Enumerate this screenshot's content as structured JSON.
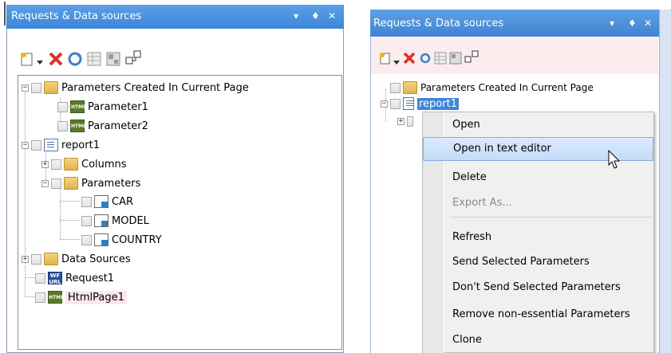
{
  "left_panel": {
    "title": "Requests & Data sources",
    "title_buttons": [
      "▾",
      "♦",
      "✕"
    ],
    "toolbar": [
      "new-icon",
      "dropdown-icon",
      "delete-icon",
      "refresh-icon",
      "grid-icon",
      "properties-icon",
      "link-icon"
    ],
    "tree": {
      "params_folder": "Parameters Created In Current Page",
      "param1": "Parameter1",
      "param2": "Parameter2",
      "report": "report1",
      "columns": "Columns",
      "parameters": "Parameters",
      "car": "CAR",
      "model": "MODEL",
      "country": "COUNTRY",
      "data_sources": "Data Sources",
      "request": "Request1",
      "htmlpage": "HtmlPage1"
    }
  },
  "right_panel": {
    "title": "Requests & Data sources",
    "title_buttons": [
      "▾",
      "♦",
      "✕"
    ],
    "tree": {
      "params_folder": "Parameters Created In Current Page",
      "report": "report1"
    },
    "context_menu": {
      "items": [
        {
          "label": "Open",
          "state": "normal"
        },
        {
          "label": "Open in text editor",
          "state": "highlighted"
        },
        {
          "label": "Delete",
          "state": "normal"
        },
        {
          "label": "Export As...",
          "state": "disabled"
        },
        {
          "label": "Refresh",
          "state": "normal"
        },
        {
          "label": "Send Selected Parameters",
          "state": "normal"
        },
        {
          "label": "Don't Send Selected Parameters",
          "state": "normal"
        },
        {
          "label": "Remove non-essential Parameters",
          "state": "normal"
        },
        {
          "label": "Clone",
          "state": "normal"
        }
      ]
    }
  },
  "colors": {
    "title_bar": "#4a92e0",
    "toolbar_tint": "#fbecee",
    "menu_highlight": "#c3dcf8",
    "selection": "#3d86d8"
  },
  "icon_glyphs": {
    "html_text": "HTML",
    "wf_text": "WF",
    "url_text": "URL"
  }
}
